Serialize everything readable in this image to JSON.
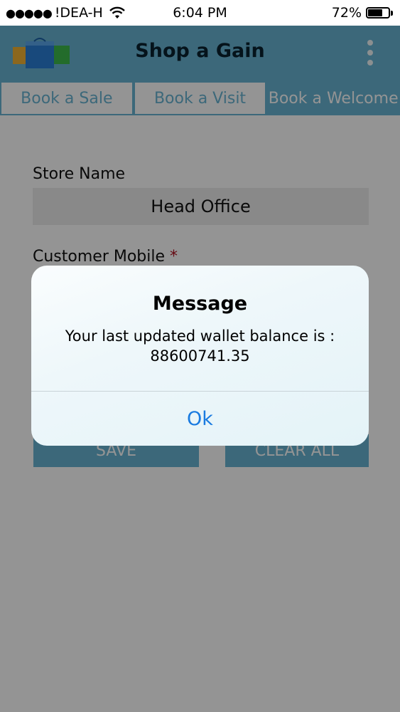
{
  "status_bar": {
    "signal": "●●●●●",
    "carrier": "!DEA-H",
    "time": "6:04 PM",
    "battery_percent": "72%",
    "battery_level": 0.72
  },
  "header": {
    "title": "Shop a Gain"
  },
  "tabs": [
    {
      "label": "Book a Sale",
      "active": false
    },
    {
      "label": "Book a Visit",
      "active": false
    },
    {
      "label": "Book a Welcome",
      "active": true
    }
  ],
  "form": {
    "store_label": "Store Name",
    "store_value": "Head Office",
    "mobile_label": "Customer Mobile",
    "required_marker": "*",
    "save_label": "SAVE",
    "clear_label": "CLEAR ALL"
  },
  "dialog": {
    "title": "Message",
    "message_line1": "Your last updated wallet balance is :",
    "message_line2": "88600741.35",
    "ok_label": "Ok"
  },
  "colors": {
    "accent": "#68b4d2",
    "link": "#1a7be0",
    "required": "#b01020"
  }
}
